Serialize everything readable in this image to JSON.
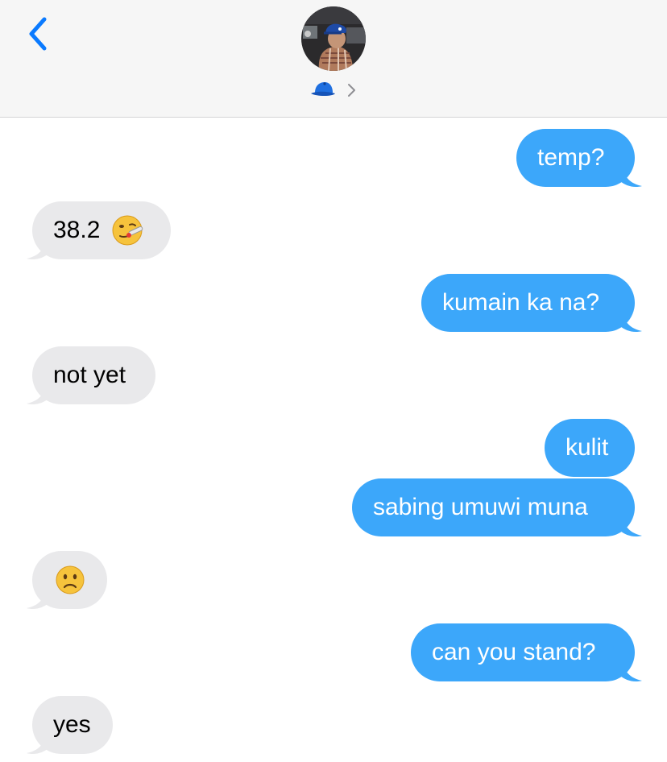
{
  "header": {
    "contact_emoji": "blue-cap-icon"
  },
  "messages": [
    {
      "direction": "outgoing",
      "text": "temp?",
      "tail": true
    },
    {
      "direction": "incoming",
      "text": "38.2",
      "emoji": "face-with-thermometer-icon",
      "tail": true
    },
    {
      "direction": "outgoing",
      "text": "kumain ka na?",
      "tail": true
    },
    {
      "direction": "incoming",
      "text": "not yet",
      "tail": true
    },
    {
      "direction": "outgoing",
      "text": "kulit",
      "tail": false
    },
    {
      "direction": "outgoing",
      "text": "sabing umuwi muna",
      "tail": true
    },
    {
      "direction": "incoming",
      "text": "",
      "emoji": "slightly-frowning-face-icon",
      "tail": true
    },
    {
      "direction": "outgoing",
      "text": "can you stand?",
      "tail": true
    },
    {
      "direction": "incoming",
      "text": "yes",
      "tail": true
    }
  ],
  "colors": {
    "outgoing_bubble": "#3ca7fa",
    "incoming_bubble": "#e9e9eb",
    "accent": "#0a7aff",
    "header_bg": "#f6f6f6"
  }
}
